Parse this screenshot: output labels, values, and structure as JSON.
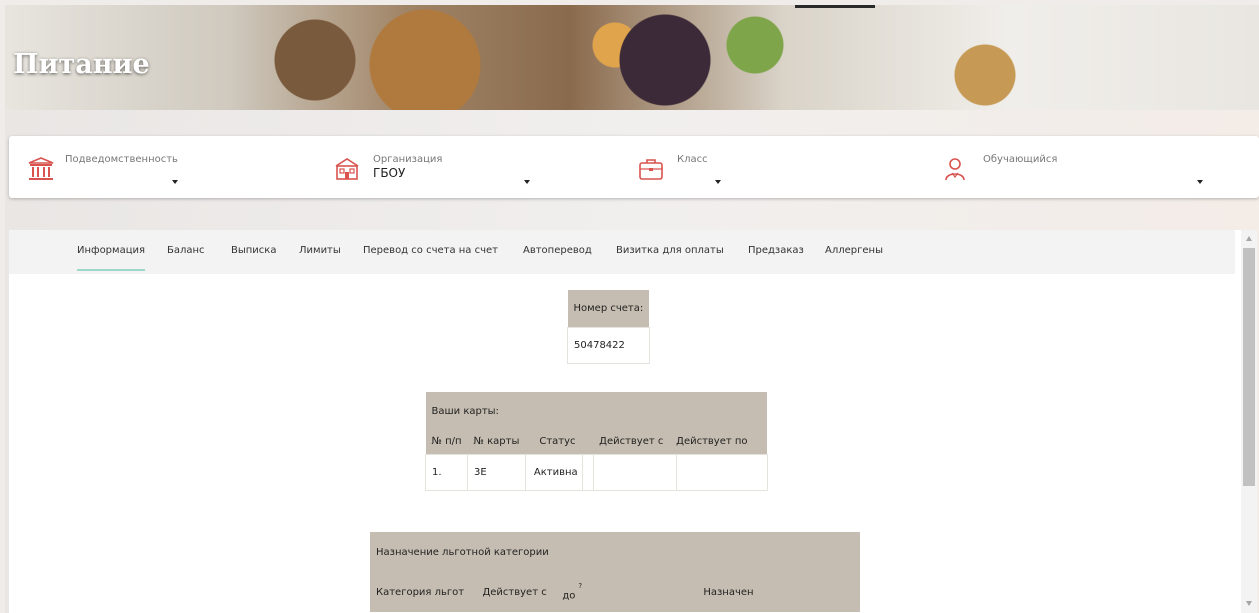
{
  "header": {
    "title": "Питание"
  },
  "filters": [
    {
      "label": "Подведомственность",
      "value": "",
      "icon": "ministry-building-icon"
    },
    {
      "label": "Организация",
      "value": "ГБОУ",
      "icon": "school-building-icon"
    },
    {
      "label": "Класс",
      "value": "",
      "icon": "briefcase-icon"
    },
    {
      "label": "Обучающийся",
      "value": "",
      "icon": "student-person-icon"
    }
  ],
  "tabs": [
    {
      "label": "Информация",
      "active": true
    },
    {
      "label": "Баланс"
    },
    {
      "label": "Выписка"
    },
    {
      "label": "Лимиты"
    },
    {
      "label": "Перевод со счета на счет"
    },
    {
      "label": "Автоперевод"
    },
    {
      "label": "Визитка для оплаты"
    },
    {
      "label": "Предзаказ"
    },
    {
      "label": "Аллергены"
    }
  ],
  "account": {
    "header": "Номер счета:",
    "number": "50478422"
  },
  "cards": {
    "title": "Ваши карты:",
    "columns": [
      "№ п/п",
      "№ карты",
      "Статус",
      "",
      "Действует с",
      "Действует по"
    ],
    "rows": [
      {
        "num": "1.",
        "card": "3E",
        "status": "Активна",
        "extra": "",
        "from": "",
        "to": ""
      }
    ]
  },
  "benefits": {
    "title": "Назначение льготной категории",
    "columns": [
      "Категория льгот",
      "Действует с",
      "до",
      "?",
      "Назначен"
    ]
  },
  "colors": {
    "accent": "#9fd8c8",
    "table_header": "#c5bdb1",
    "icon_red": "#d9534f"
  }
}
